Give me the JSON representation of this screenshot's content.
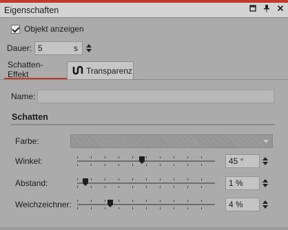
{
  "window": {
    "title": "Eigenschaften",
    "accent_color": "#c0392b",
    "icons": [
      "restore-icon",
      "pin-icon",
      "close-icon"
    ]
  },
  "show_object": {
    "label": "Objekt anzeigen",
    "checked": true
  },
  "duration": {
    "label": "Dauer:",
    "value": "5",
    "unit": "s"
  },
  "tabs": [
    {
      "label": "Schatten-Effekt",
      "active": true
    },
    {
      "label": "Transparenz",
      "active": false,
      "icon": "transparency-icon"
    }
  ],
  "name_field": {
    "label": "Name:",
    "value": ""
  },
  "section": {
    "title": "Schatten"
  },
  "color": {
    "label": "Farbe:"
  },
  "sliders": [
    {
      "label": "Winkel:",
      "value": "45 °",
      "position": 0.47
    },
    {
      "label": "Abstand:",
      "value": "1 %",
      "position": 0.06
    },
    {
      "label": "Weichzeichner:",
      "value": "4 %",
      "position": 0.24
    }
  ]
}
